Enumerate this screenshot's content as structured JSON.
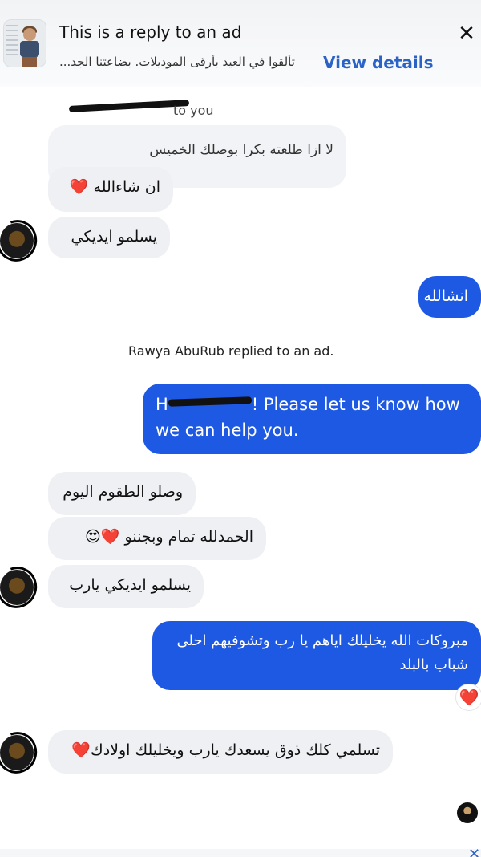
{
  "ad_header": {
    "title": "This is a reply to an ad",
    "snippet": "تألقوا في العيد بأرقى الموديلات. بضاعتنا الجد...",
    "view_details": "View details",
    "close": "✕"
  },
  "messages": {
    "reply_note_1": "to you",
    "quoted_message": "لا ازا طلعته بكرا بوصلك الخميس",
    "msg_1": "ان شاءالله",
    "msg_1_emoji": "❤️",
    "msg_2": "يسلمو ايديكي",
    "msg_3_out": "انشالله",
    "reply_note_2": "Rawya AbuRub replied to an ad.",
    "msg_4_out_prefix": "H",
    "msg_4_out_rest": "! Please let us know how we can help you.",
    "msg_5": "وصلو الطقوم اليوم",
    "msg_6": "الحمدلله تمام وبجننو",
    "msg_6_emoji": "❤️😍",
    "msg_7": "يسلمو ايديكي يارب",
    "msg_8_out": "مبروكات الله يخليلك اياهم يا رب وتشوفيهم احلى شباب بالبلد",
    "msg_8_reaction": "❤️",
    "msg_9": "تسلمي كلك ذوق يسعدك يارب ويخليلك اولادك",
    "msg_9_emoji": "❤️"
  },
  "colors": {
    "outgoing": "#1d59e3",
    "incoming": "#eef0f3",
    "link": "#2b62c6"
  }
}
